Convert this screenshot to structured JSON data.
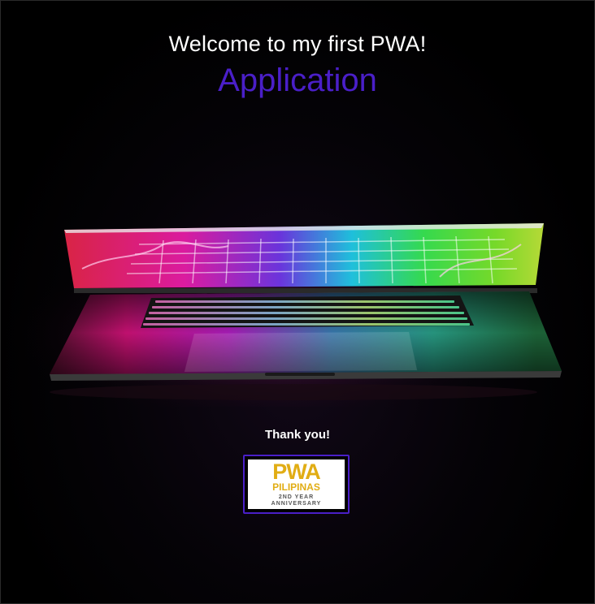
{
  "header": {
    "welcome_text": "Welcome to my first PWA!",
    "app_title": "Application"
  },
  "hero_image": {
    "icon": "laptop-rgb-keyboard-image"
  },
  "footer": {
    "thanks_text": "Thank you!",
    "badge": {
      "logo_text": "PWA",
      "subtitle": "PILIPINAS",
      "year_text": "2ND YEAR",
      "anniversary_text": "ANNIVERSARY"
    }
  },
  "colors": {
    "accent": "#4a1fc8",
    "badge_gold": "#e1ad14",
    "background": "#000000",
    "text": "#ffffff"
  }
}
